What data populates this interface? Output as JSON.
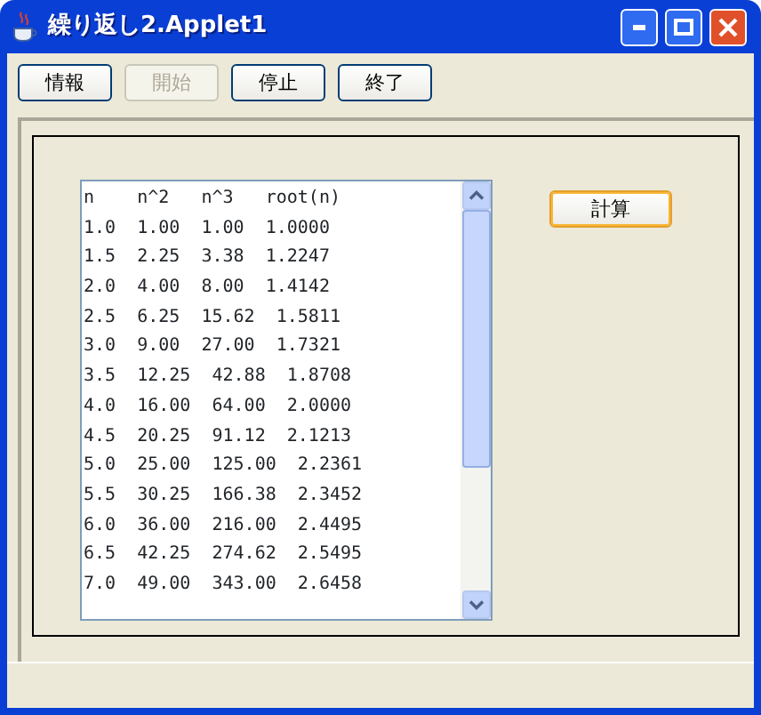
{
  "window": {
    "title": "繰り返し2.Applet1"
  },
  "buttons": [
    {
      "label": "情報",
      "disabled": false
    },
    {
      "label": "開始",
      "disabled": true
    },
    {
      "label": "停止",
      "disabled": false
    },
    {
      "label": "終了",
      "disabled": false
    }
  ],
  "output": {
    "lines": [
      "n    n^2   n^3   root(n)",
      "1.0  1.00  1.00  1.0000",
      "1.5  2.25  3.38  1.2247",
      "2.0  4.00  8.00  1.4142",
      "2.5  6.25  15.62  1.5811",
      "3.0  9.00  27.00  1.7321",
      "3.5  12.25  42.88  1.8708",
      "4.0  16.00  64.00  2.0000",
      "4.5  20.25  91.12  2.1213",
      "5.0  25.00  125.00  2.2361",
      "5.5  30.25  166.38  2.3452",
      "6.0  36.00  216.00  2.4495",
      "6.5  42.25  274.62  2.5495",
      "7.0  49.00  343.00  2.6458"
    ]
  },
  "calc_button": {
    "label": "計算",
    "focused": true
  }
}
